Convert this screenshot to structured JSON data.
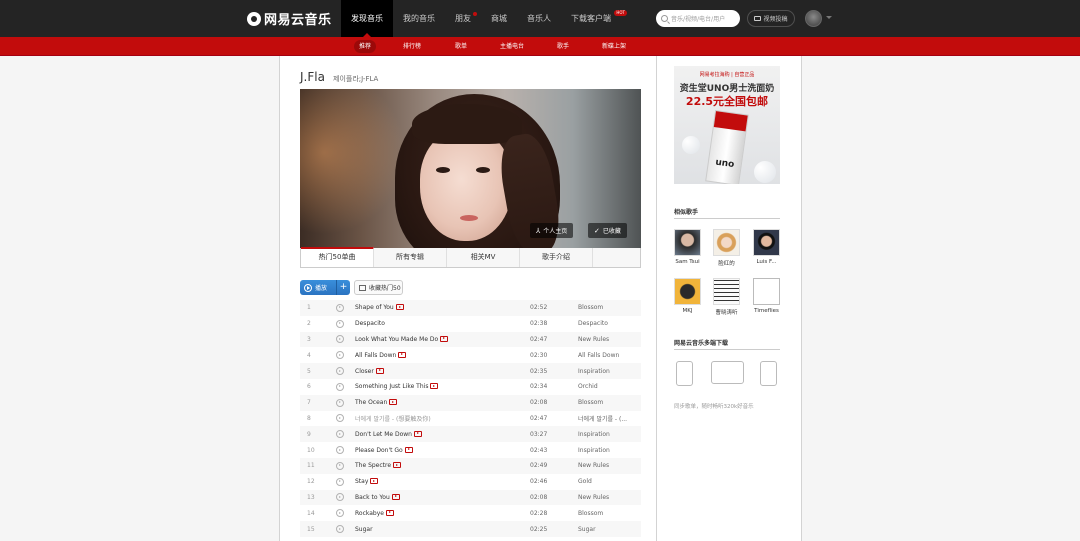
{
  "header": {
    "logo_text": "网易云音乐",
    "nav": [
      {
        "label": "发现音乐",
        "active": true
      },
      {
        "label": "我的音乐"
      },
      {
        "label": "朋友",
        "dot": true
      },
      {
        "label": "商城"
      },
      {
        "label": "音乐人"
      },
      {
        "label": "下载客户端",
        "badge": "HOT"
      }
    ],
    "search_placeholder": "音乐/视频/电台/用户",
    "creator_label": "视频投稿"
  },
  "subnav": [
    {
      "label": "推荐",
      "active": true
    },
    {
      "label": "排行榜"
    },
    {
      "label": "歌单"
    },
    {
      "label": "主播电台"
    },
    {
      "label": "歌手"
    },
    {
      "label": "新碟上架"
    }
  ],
  "artist": {
    "name": "J.Fla",
    "alias": "제이플라;J-FLA",
    "home_button": "个人主页",
    "followed_button": "已收藏"
  },
  "tabs": [
    "热门50单曲",
    "所有专辑",
    "相关MV",
    "歌手介绍"
  ],
  "actions": {
    "play_label": "播放",
    "add_label": "+",
    "collect_label": "收藏热门50"
  },
  "songs": [
    {
      "idx": "1",
      "title": "Shape of You",
      "mv": true,
      "dur": "02:52",
      "album": "Blossom"
    },
    {
      "idx": "2",
      "title": "Despacito",
      "mv": false,
      "dur": "02:38",
      "album": "Despacito"
    },
    {
      "idx": "3",
      "title": "Look What You Made Me Do",
      "mv": true,
      "dur": "02:47",
      "album": "New Rules"
    },
    {
      "idx": "4",
      "title": "All Falls Down",
      "mv": true,
      "dur": "02:30",
      "album": "All Falls Down"
    },
    {
      "idx": "5",
      "title": "Closer",
      "mv": true,
      "dur": "02:35",
      "album": "Inspiration"
    },
    {
      "idx": "6",
      "title": "Something Just Like This",
      "mv": true,
      "dur": "02:34",
      "album": "Orchid"
    },
    {
      "idx": "7",
      "title": "The Ocean",
      "mv": true,
      "dur": "02:08",
      "album": "Blossom"
    },
    {
      "idx": "8",
      "title": "너에게 말기를 - (想要触及你)",
      "mv": false,
      "dur": "02:47",
      "album": "너에게 말기를 - (...",
      "gray": true
    },
    {
      "idx": "9",
      "title": "Don't Let Me Down",
      "mv": true,
      "dur": "03:27",
      "album": "Inspiration"
    },
    {
      "idx": "10",
      "title": "Please Don't Go",
      "mv": true,
      "dur": "02:43",
      "album": "Inspiration"
    },
    {
      "idx": "11",
      "title": "The Spectre",
      "mv": true,
      "dur": "02:49",
      "album": "New Rules"
    },
    {
      "idx": "12",
      "title": "Stay",
      "mv": true,
      "dur": "02:46",
      "album": "Gold"
    },
    {
      "idx": "13",
      "title": "Back to You",
      "mv": true,
      "dur": "02:08",
      "album": "New Rules"
    },
    {
      "idx": "14",
      "title": "Rockabye",
      "mv": true,
      "dur": "02:28",
      "album": "Blossom"
    },
    {
      "idx": "15",
      "title": "Sugar",
      "mv": false,
      "dur": "02:25",
      "album": "Sugar"
    }
  ],
  "ad": {
    "brand_line": "网易考拉海购 | 自营正品",
    "line1": "资生堂UNO男士洗面奶",
    "line2": "22.5元全国包邮",
    "product_word": "uno"
  },
  "similar": {
    "title": "相似歌手",
    "artists": [
      "Sam Tsui",
      "脸红的",
      "Luis F...",
      "MKJ",
      "曹晓涛听",
      "Timeflies"
    ]
  },
  "download": {
    "title": "网易云音乐多端下载",
    "caption": "同步歌单，随时畅听320k好音乐"
  },
  "colors": {
    "brand_red": "#c20c0c",
    "topbar": "#242424",
    "play_blue": "#2b73c1"
  }
}
